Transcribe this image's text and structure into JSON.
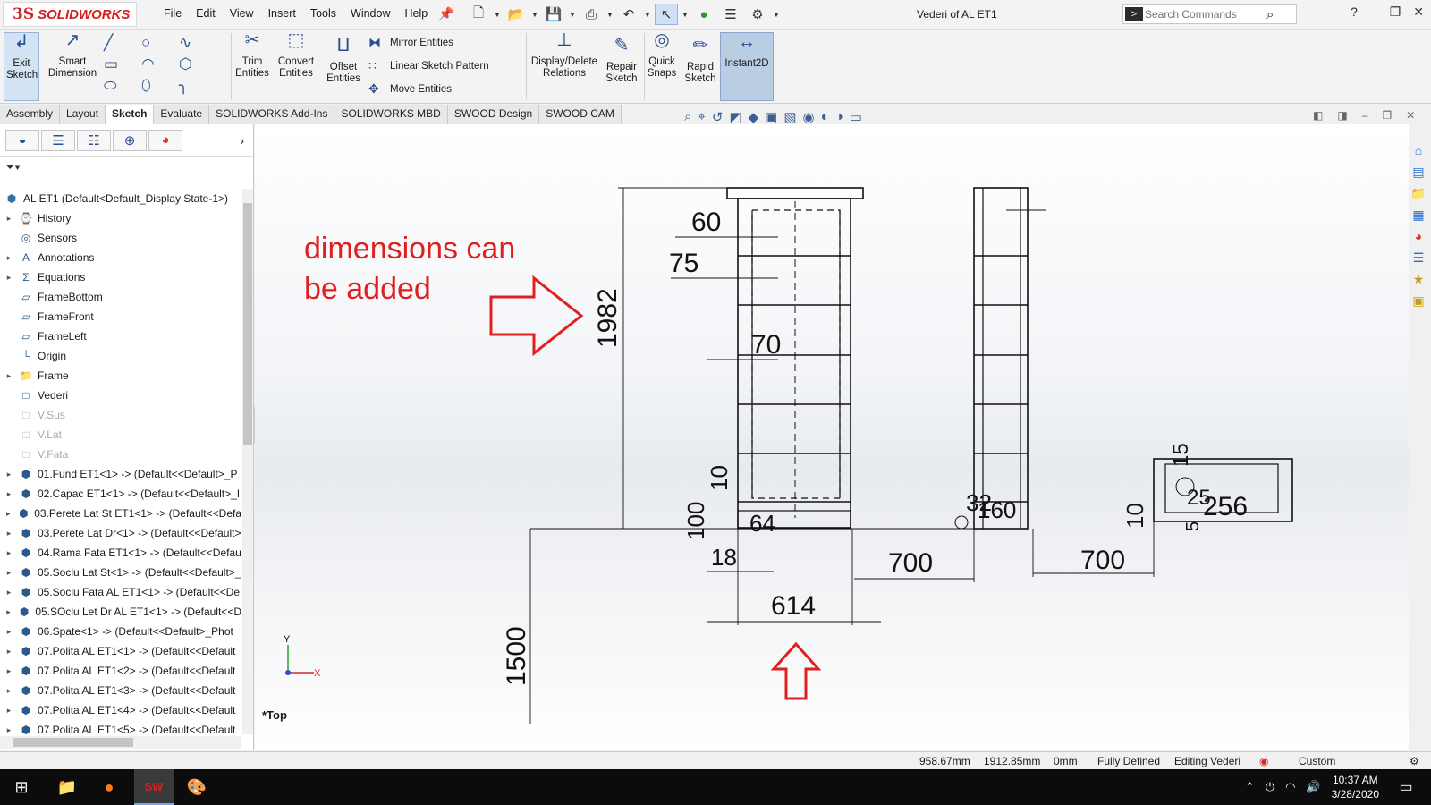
{
  "app": {
    "logo_ds": "3S",
    "logo_text": "SOLIDWORKS",
    "window_title": "Vederi of AL ET1"
  },
  "menu": [
    "File",
    "Edit",
    "View",
    "Insert",
    "Tools",
    "Window",
    "Help"
  ],
  "search": {
    "placeholder": "Search Commands"
  },
  "ribbon": {
    "exit_sketch": "Exit Sketch",
    "smart_dimension": "Smart Dimension",
    "trim_entities": "Trim Entities",
    "convert_entities": "Convert Entities",
    "offset_entities": "Offset Entities",
    "mirror_entities": "Mirror Entities",
    "linear_sketch_pattern": "Linear Sketch Pattern",
    "move_entities": "Move Entities",
    "display_delete_relations": "Display/Delete Relations",
    "repair_sketch": "Repair Sketch",
    "quick_snaps": "Quick Snaps",
    "rapid_sketch": "Rapid Sketch",
    "instant2d": "Instant2D"
  },
  "tabs": [
    "Assembly",
    "Layout",
    "Sketch",
    "Evaluate",
    "SOLIDWORKS Add-Ins",
    "SOLIDWORKS MBD",
    "SWOOD Design",
    "SWOOD CAM"
  ],
  "active_tab": "Sketch",
  "tree": {
    "root": "AL ET1  (Default<Default_Display State-1>)",
    "items": [
      {
        "label": "History",
        "icon": "history-icon",
        "expand": true,
        "dim": false
      },
      {
        "label": "Sensors",
        "icon": "sensor-icon",
        "expand": false,
        "dim": false
      },
      {
        "label": "Annotations",
        "icon": "annotation-icon",
        "expand": true,
        "dim": false
      },
      {
        "label": "Equations",
        "icon": "equation-icon",
        "expand": true,
        "dim": false
      },
      {
        "label": "FrameBottom",
        "icon": "plane-icon",
        "expand": false,
        "dim": false
      },
      {
        "label": "FrameFront",
        "icon": "plane-icon",
        "expand": false,
        "dim": false
      },
      {
        "label": "FrameLeft",
        "icon": "plane-icon",
        "expand": false,
        "dim": false
      },
      {
        "label": "Origin",
        "icon": "origin-icon",
        "expand": false,
        "dim": false
      },
      {
        "label": "Frame",
        "icon": "folder-icon",
        "expand": true,
        "dim": false
      },
      {
        "label": "Vederi",
        "icon": "sketch-icon",
        "expand": false,
        "dim": false
      },
      {
        "label": "V.Sus",
        "icon": "sketch-icon",
        "expand": false,
        "dim": true
      },
      {
        "label": "V.Lat",
        "icon": "sketch-icon",
        "expand": false,
        "dim": true
      },
      {
        "label": "V.Fata",
        "icon": "sketch-icon",
        "expand": false,
        "dim": true
      },
      {
        "label": "01.Fund ET1<1> -> (Default<<Default>_P",
        "icon": "part-icon",
        "expand": true,
        "dim": false
      },
      {
        "label": "02.Capac ET1<1> -> (Default<<Default>_I",
        "icon": "part-icon",
        "expand": true,
        "dim": false
      },
      {
        "label": "03.Perete Lat St ET1<1> -> (Default<<Defa",
        "icon": "part-icon",
        "expand": true,
        "dim": false
      },
      {
        "label": "03.Perete Lat Dr<1> -> (Default<<Default>",
        "icon": "part-icon",
        "expand": true,
        "dim": false
      },
      {
        "label": "04.Rama Fata ET1<1> -> (Default<<Defau",
        "icon": "part-icon",
        "expand": true,
        "dim": false
      },
      {
        "label": "05.Soclu Lat St<1> -> (Default<<Default>_",
        "icon": "part-icon",
        "expand": true,
        "dim": false
      },
      {
        "label": "05.Soclu Fata AL ET1<1> -> (Default<<De",
        "icon": "part-icon",
        "expand": true,
        "dim": false
      },
      {
        "label": "05.SOclu Let Dr AL ET1<1> -> (Default<<D",
        "icon": "part-icon",
        "expand": true,
        "dim": false
      },
      {
        "label": "06.Spate<1> -> (Default<<Default>_Phot",
        "icon": "part-icon",
        "expand": true,
        "dim": false
      },
      {
        "label": "07.Polita AL ET1<1> -> (Default<<Default",
        "icon": "part-icon",
        "expand": true,
        "dim": false
      },
      {
        "label": "07.Polita AL ET1<2> -> (Default<<Default",
        "icon": "part-icon",
        "expand": true,
        "dim": false
      },
      {
        "label": "07.Polita AL ET1<3> -> (Default<<Default",
        "icon": "part-icon",
        "expand": true,
        "dim": false
      },
      {
        "label": "07.Polita AL ET1<4> -> (Default<<Default",
        "icon": "part-icon",
        "expand": true,
        "dim": false
      },
      {
        "label": "07.Polita AL ET1<5> -> (Default<<Default",
        "icon": "part-icon",
        "expand": true,
        "dim": false
      }
    ]
  },
  "canvas": {
    "annotation_text": [
      "dimensions can",
      "be added"
    ],
    "view_label": "*Top",
    "axis_x": "X",
    "axis_y": "Y",
    "dimensions": [
      "60",
      "75",
      "1982",
      "70",
      "10",
      "100",
      "64",
      "18",
      "614",
      "1500",
      "700",
      "700",
      "32",
      "160",
      "15",
      "25",
      "256",
      "10",
      "5"
    ]
  },
  "status": {
    "x": "958.67mm",
    "y": "1912.85mm",
    "z": "0mm",
    "state": "Fully Defined",
    "editing": "Editing Vederi",
    "units": "Custom"
  },
  "taskbar": {
    "time": "10:37 AM",
    "date": "3/28/2020"
  },
  "colors": {
    "annotation_red": "#e02020",
    "accent_blue": "#2a6bd1"
  }
}
